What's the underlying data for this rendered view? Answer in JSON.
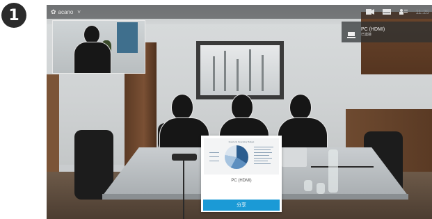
{
  "step": {
    "number": "1"
  },
  "topbar": {
    "brand": "acano",
    "time": "11:25",
    "icons": [
      "gear-icon",
      "signal-icon",
      "camera-icon",
      "keyboard-icon",
      "participants-icon"
    ]
  },
  "source": {
    "name": "PC (HDMI)",
    "status": "已連接"
  },
  "share_card": {
    "label": "PC (HDMI)",
    "button_label": "分享",
    "preview_title": "Quarterly Operating Budget",
    "accent": "#1b9ad6"
  }
}
